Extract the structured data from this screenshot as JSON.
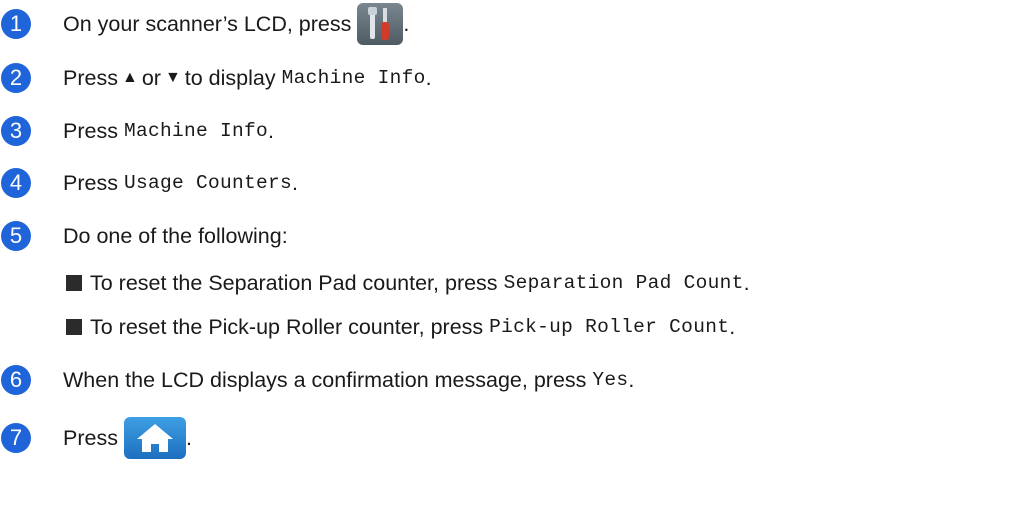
{
  "steps": [
    {
      "num": "1",
      "text": "On your scanner’s LCD, press",
      "icon": "tools-icon",
      "after": "."
    },
    {
      "num": "2",
      "pre": "Press",
      "up": "▲",
      "or": "or",
      "down": "▼",
      "mid": "to display",
      "code": "Machine Info",
      "after": "."
    },
    {
      "num": "3",
      "pre": "Press",
      "code": "Machine Info",
      "after": "."
    },
    {
      "num": "4",
      "pre": "Press",
      "code": "Usage Counters",
      "after": "."
    },
    {
      "num": "5",
      "text": "Do one of the following:",
      "bullets": [
        {
          "pre": "To reset the Separation Pad counter, press",
          "code": "Separation Pad Count",
          "after": "."
        },
        {
          "pre": "To reset the Pick-up Roller counter, press",
          "code": "Pick-up Roller Count",
          "after": "."
        }
      ]
    },
    {
      "num": "6",
      "pre": "When the LCD displays a confirmation message, press",
      "code": "Yes",
      "after": "."
    },
    {
      "num": "7",
      "pre": "Press",
      "icon": "home-icon",
      "after": "."
    }
  ],
  "colors": {
    "step_circle": "#1f64d8",
    "tools_icon_bg": "#5f6b74",
    "home_icon_bg": "#2a86d3"
  }
}
